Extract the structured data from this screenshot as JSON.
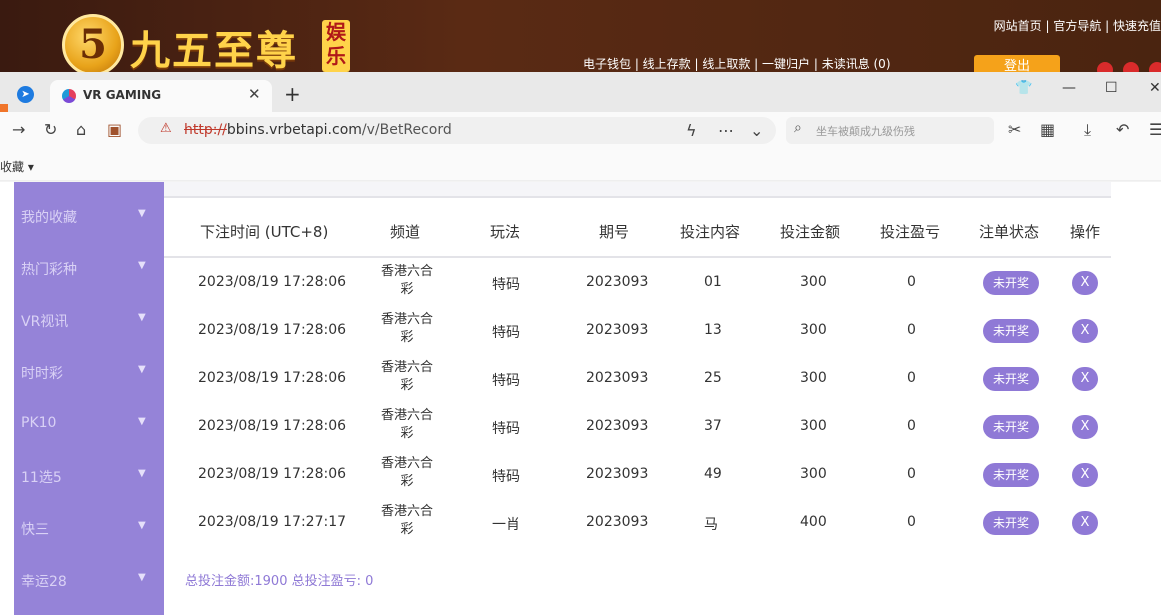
{
  "site": {
    "logo_digit": "5",
    "logo_text": "九五至尊",
    "logo_tag": "娱乐",
    "top_links": "网站首页 | 官方导航 | 快速充值",
    "mid_links": "电子钱包 | 线上存款 | 线上取款 | 一键归户 | 未读讯息 (0)",
    "login_label": "登出"
  },
  "browser": {
    "tab_title": "VR GAMING",
    "new_tab": "+",
    "url_proto": "http://",
    "url_host": "bbins.vrbetapi.com",
    "url_path": "/v/BetRecord",
    "search_placeholder": "坐车被颠成九级伤残",
    "bookmarks_label": "收藏 ▾"
  },
  "sidebar": {
    "items": [
      {
        "label": "我的收藏"
      },
      {
        "label": "热门彩种"
      },
      {
        "label": "VR视讯"
      },
      {
        "label": "时时彩"
      },
      {
        "label": "PK10"
      },
      {
        "label": "11选5"
      },
      {
        "label": "快三"
      },
      {
        "label": "幸运28"
      }
    ]
  },
  "table": {
    "headers": [
      "下注时间 (UTC+8)",
      "频道",
      "玩法",
      "期号",
      "投注内容",
      "投注金额",
      "投注盈亏",
      "注单状态",
      "操作"
    ],
    "rows": [
      {
        "time": "2023/08/19 17:28:06",
        "channel": "香港六合彩",
        "play": "特码",
        "period": "2023093",
        "content": "01",
        "amount": "300",
        "pnl": "0",
        "status": "未开奖",
        "action": "X"
      },
      {
        "time": "2023/08/19 17:28:06",
        "channel": "香港六合彩",
        "play": "特码",
        "period": "2023093",
        "content": "13",
        "amount": "300",
        "pnl": "0",
        "status": "未开奖",
        "action": "X"
      },
      {
        "time": "2023/08/19 17:28:06",
        "channel": "香港六合彩",
        "play": "特码",
        "period": "2023093",
        "content": "25",
        "amount": "300",
        "pnl": "0",
        "status": "未开奖",
        "action": "X"
      },
      {
        "time": "2023/08/19 17:28:06",
        "channel": "香港六合彩",
        "play": "特码",
        "period": "2023093",
        "content": "37",
        "amount": "300",
        "pnl": "0",
        "status": "未开奖",
        "action": "X"
      },
      {
        "time": "2023/08/19 17:28:06",
        "channel": "香港六合彩",
        "play": "特码",
        "period": "2023093",
        "content": "49",
        "amount": "300",
        "pnl": "0",
        "status": "未开奖",
        "action": "X"
      },
      {
        "time": "2023/08/19 17:27:17",
        "channel": "香港六合彩",
        "play": "一肖",
        "period": "2023093",
        "content": "马",
        "amount": "400",
        "pnl": "0",
        "status": "未开奖",
        "action": "X"
      }
    ],
    "summary": "总投注金额:1900 总投注盈亏: 0"
  },
  "colors": {
    "sidebar_bg": "#9583d8",
    "accent": "#8f79d6",
    "header_bg": "#4a2410"
  }
}
